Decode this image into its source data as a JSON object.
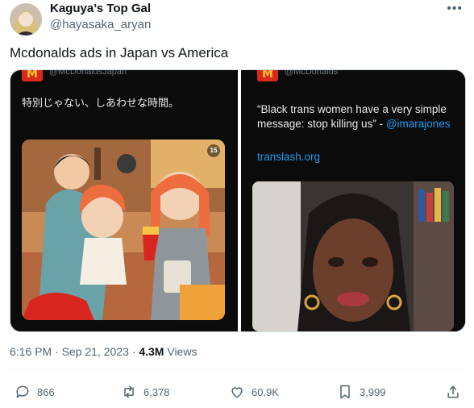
{
  "author": {
    "name": "Kaguya’s Top Gal",
    "handle": "@hayasaka_aryan"
  },
  "more_icon": "more-horizontal-icon",
  "tweet_text": "Mcdonalds ads in Japan vs America",
  "media": {
    "left": {
      "handle": "@McDonaldsJapan",
      "text": "特別じゃない、しあわせな時間。",
      "badge": "15"
    },
    "right": {
      "handle": "@McDonalds",
      "quote": "“Black trans women have a very simple message: stop killing us” - ",
      "mention": "@imarajones",
      "link": "translash.org"
    }
  },
  "meta": {
    "time": "6:16 PM",
    "date": "Sep 21, 2023",
    "views_count": "4.3M",
    "views_label": "Views"
  },
  "actions": {
    "replies": "866",
    "reposts": "6,378",
    "likes": "60.9K",
    "bookmarks": "3,999"
  },
  "colors": {
    "accent": "#1d9bf0",
    "mcdonalds_red": "#da291c",
    "mcdonalds_yellow": "#ffc72c"
  }
}
